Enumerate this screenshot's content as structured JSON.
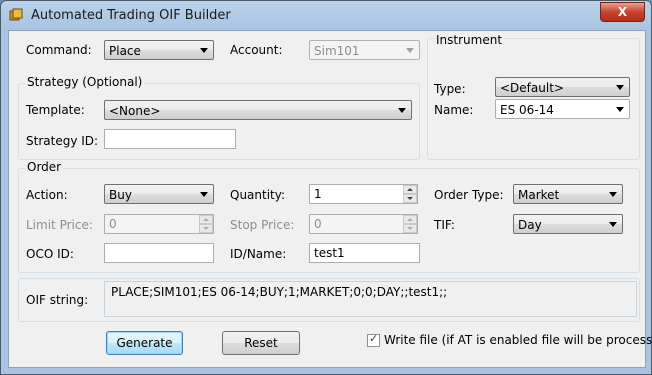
{
  "window": {
    "title": "Automated Trading OIF Builder",
    "close_label": "X"
  },
  "command": {
    "label": "Command:",
    "value": "Place"
  },
  "account": {
    "label": "Account:",
    "value": "Sim101"
  },
  "instrument": {
    "group_title": "Instrument",
    "type_label": "Type:",
    "type_value": "<Default>",
    "name_label": "Name:",
    "name_value": "ES 06-14"
  },
  "strategy": {
    "group_title": "Strategy (Optional)",
    "template_label": "Template:",
    "template_value": "<None>",
    "id_label": "Strategy ID:",
    "id_value": ""
  },
  "order": {
    "group_title": "Order",
    "action_label": "Action:",
    "action_value": "Buy",
    "quantity_label": "Quantity:",
    "quantity_value": "1",
    "order_type_label": "Order Type:",
    "order_type_value": "Market",
    "limit_price_label": "Limit Price:",
    "limit_price_value": "0",
    "stop_price_label": "Stop Price:",
    "stop_price_value": "0",
    "tif_label": "TIF:",
    "tif_value": "Day",
    "oco_label": "OCO ID:",
    "oco_value": "",
    "idname_label": "ID/Name:",
    "idname_value": "test1"
  },
  "oif": {
    "label": "OIF string:",
    "value": "PLACE;SIM101;ES 06-14;BUY;1;MARKET;0;0;DAY;;test1;;"
  },
  "buttons": {
    "generate": "Generate",
    "reset": "Reset"
  },
  "write_file": {
    "label": "Write file (if AT is enabled file will be processed)",
    "checked": true
  }
}
